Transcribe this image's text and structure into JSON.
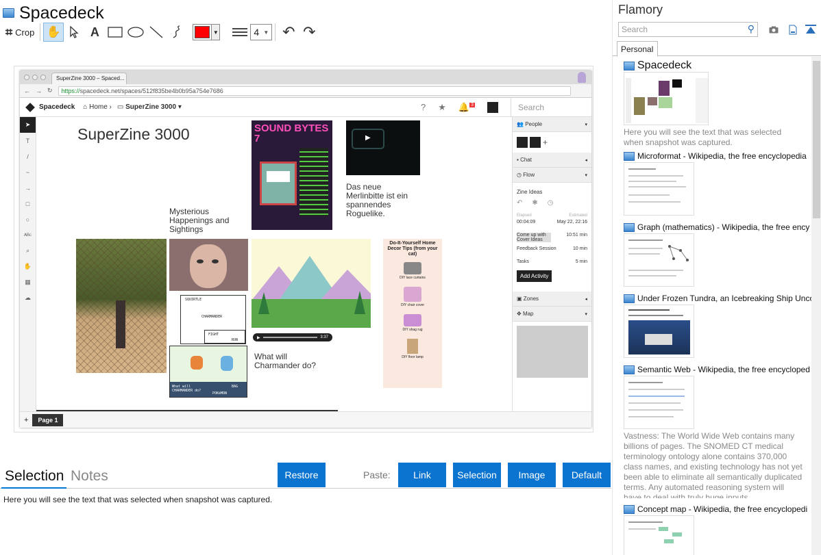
{
  "app": {
    "title": "Spacedeck"
  },
  "toolbar": {
    "crop_label": "Crop",
    "color": "#ff0000",
    "line_width": "4"
  },
  "screenshot": {
    "tab_title": "SuperZine 3000 – Spaced...",
    "url_scheme": "https://",
    "url_rest": "spacedeck.net/spaces/512f835be4b0b95a754e7686",
    "brand": "Spacedeck",
    "crumb_home": "Home",
    "crumb_space": "SuperZine 3000",
    "notif_count": "3",
    "search_placeholder": "Search",
    "zine_title": "SuperZine 3000",
    "text_mysterious": "Mysterious Happenings and Sightings",
    "text_merlin": "Das neue Merlinbitte ist ein spannendes Roguelike.",
    "text_charmander": "What will Charmander do?",
    "poster_title": "SOUND BYTES 7",
    "decor_title": "Do-It-Yourself Home Decor Tips (from your cat)",
    "decor_items": [
      "DIY lace curtains",
      "DIY chair cover",
      "DIY shag rug",
      "DIY floor lamp"
    ],
    "pokemon": {
      "squirtle": "SQUIRTLE",
      "charmander": "CHARMANDER",
      "fight": "FIGHT",
      "item": "ITEM",
      "run": "RUN",
      "bag": "BAG",
      "pkmn": "POKéMON",
      "what_will": "What will CHARMANDER do?"
    },
    "panel": {
      "people": "People",
      "chat": "Chat",
      "flow": "Flow",
      "zine_ideas": "Zine Ideas",
      "elapsed_label": "Elapsed",
      "estimated_label": "Estimated",
      "elapsed": "00:04:09",
      "estimated": "May 22, 22:16",
      "activities": [
        {
          "name": "Come up with Cover Ideas",
          "time": "10:51 min"
        },
        {
          "name": "Feedback Session",
          "time": "10 min"
        },
        {
          "name": "Tasks",
          "time": "5 min"
        }
      ],
      "add_activity": "Add Activity",
      "zones": "Zones",
      "map": "Map"
    },
    "page_tab": "Page 1",
    "video_time": "3:37"
  },
  "bottom": {
    "tab_selection": "Selection",
    "tab_notes": "Notes",
    "restore": "Restore",
    "paste_label": "Paste:",
    "paste_link": "Link",
    "paste_selection": "Selection",
    "paste_image": "Image",
    "paste_default": "Default",
    "selection_text": "Here you will see the text that was selected when snapshot was captured."
  },
  "flamory": {
    "title": "Flamory",
    "search_placeholder": "Search",
    "tab_personal": "Personal",
    "items": [
      {
        "title": "Spacedeck",
        "desc": "Here you will see the text that was selected when snapshot was captured."
      },
      {
        "title": "Microformat - Wikipedia, the free encyclopedia",
        "desc": ""
      },
      {
        "title": "Graph (mathematics) - Wikipedia, the free ency",
        "desc": ""
      },
      {
        "title": "Under Frozen Tundra, an Icebreaking Ship Unco",
        "desc": ""
      },
      {
        "title": "Semantic Web - Wikipedia, the free encycloped",
        "desc": "Vastness: The World Wide Web contains many billions of pages. The SNOMED CT medical terminology ontology alone contains 370,000 class names, and existing technology has not yet been able to eliminate all semantically duplicated terms. Any automated reasoning system will have to deal with truly huge inputs."
      },
      {
        "title": "Concept map - Wikipedia, the free encyclopedi",
        "desc": ""
      }
    ]
  },
  "colors": {
    "accent": "#0a74d0",
    "draw_color": "#ff0000"
  }
}
